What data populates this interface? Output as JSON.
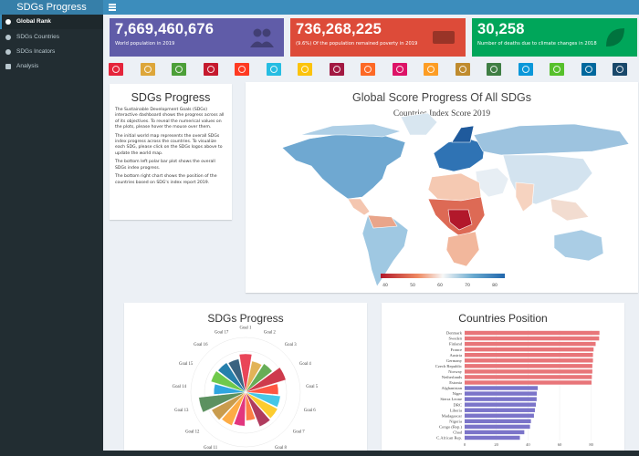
{
  "app": {
    "title": "SDGs Progress"
  },
  "sidebar": {
    "items": [
      {
        "label": "Global Rank",
        "icon": "globe-icon",
        "active": true
      },
      {
        "label": "SDGs Countries",
        "icon": "globe-icon",
        "active": false
      },
      {
        "label": "SDGs Incators",
        "icon": "globe-icon",
        "active": false
      },
      {
        "label": "Analysis",
        "icon": "table-icon",
        "active": false
      }
    ]
  },
  "value_boxes": [
    {
      "value": "7,669,460,676",
      "label": "World population in 2019",
      "color": "#605ca8",
      "icon": "users-icon"
    },
    {
      "value": "736,268,225",
      "label": "(9.6%) Of the population remained poverty in 2019",
      "color": "#dd4b39",
      "icon": "money-icon"
    },
    {
      "value": "30,258",
      "label": "Number of deaths due to climate changes in 2018",
      "color": "#00a65a",
      "icon": "leaf-icon"
    }
  ],
  "sdg_tiles": [
    "#e5243b",
    "#dda63a",
    "#4c9f38",
    "#c5192d",
    "#ff3a21",
    "#26bde2",
    "#fcc30b",
    "#a21942",
    "#fd6925",
    "#dd1367",
    "#fd9d24",
    "#bf8b2e",
    "#3f7e44",
    "#0a97d9",
    "#56c02b",
    "#00689d",
    "#19486a"
  ],
  "info": {
    "title": "SDGs Progress",
    "paragraphs": [
      "The Sustainable Development Goals (SDGs) interactive dashboard shows the progress across all of its objectives. To reveal the numerical values on the plots, please hover the mouse over them.",
      "The initial world map represents the overall SDGs index progress across the countries. To visualize each SDG, please click on the SDGs logos above to update the world map.",
      "The bottom left polar bar plot shows the overall SDGs index progress.",
      "The bottom right chart shows the position of the countries based on SDG's index report 2019."
    ]
  },
  "map": {
    "title": "Global Score Progress Of All SDGs",
    "subtitle": "Countries Index Score 2019",
    "colorbar_ticks": [
      "40",
      "50",
      "60",
      "70",
      "80"
    ],
    "colors": [
      "#b2182b",
      "#ef8a62",
      "#fddbc7",
      "#d1e5f0",
      "#67a9cf",
      "#2166ac"
    ]
  },
  "chart_data": [
    {
      "type": "bar",
      "subtype": "polar",
      "title": "SDGs Progress",
      "categories": [
        "Goal 1",
        "Goal 2",
        "Goal 3",
        "Goal 4",
        "Goal 5",
        "Goal 6",
        "Goal 7",
        "Goal 8",
        "Goal 9",
        "Goal 10",
        "Goal 11",
        "Goal 12",
        "Goal 13",
        "Goal 14",
        "Goal 15",
        "Goal 16",
        "Goal 17"
      ],
      "values": [
        70,
        58,
        62,
        77,
        60,
        64,
        66,
        68,
        52,
        62,
        66,
        70,
        86,
        58,
        66,
        64,
        62
      ],
      "colors": [
        "#e5243b",
        "#dda63a",
        "#4c9f38",
        "#c5192d",
        "#ff3a21",
        "#26bde2",
        "#fcc30b",
        "#a21942",
        "#fd6925",
        "#dd1367",
        "#fd9d24",
        "#bf8b2e",
        "#3f7e44",
        "#0a97d9",
        "#56c02b",
        "#00689d",
        "#19486a"
      ],
      "rmax": 100
    },
    {
      "type": "bar",
      "orientation": "horizontal",
      "title": "Countries Position",
      "categories": [
        "Denmark",
        "Sweden",
        "Finland",
        "France",
        "Austria",
        "Germany",
        "Czech Republic",
        "Norway",
        "Netherlands",
        "Estonia",
        "Afghanistan",
        "Niger",
        "Sierra Leone",
        "DRC",
        "Liberia",
        "Madagascar",
        "Nigeria",
        "Congo (Rep.)",
        "Chad",
        "C.African Rep."
      ],
      "values": [
        85.2,
        85.0,
        82.8,
        81.5,
        81.1,
        81.1,
        80.7,
        80.7,
        80.4,
        80.2,
        46.2,
        45.6,
        45.5,
        45.0,
        44.4,
        43.8,
        41.9,
        41.3,
        37.7,
        34.9
      ],
      "group_colors": [
        "#e87579",
        "#7b74c9"
      ],
      "xticks": [
        "0",
        "20",
        "40",
        "60",
        "80"
      ],
      "xlim": [
        0,
        90
      ]
    }
  ]
}
